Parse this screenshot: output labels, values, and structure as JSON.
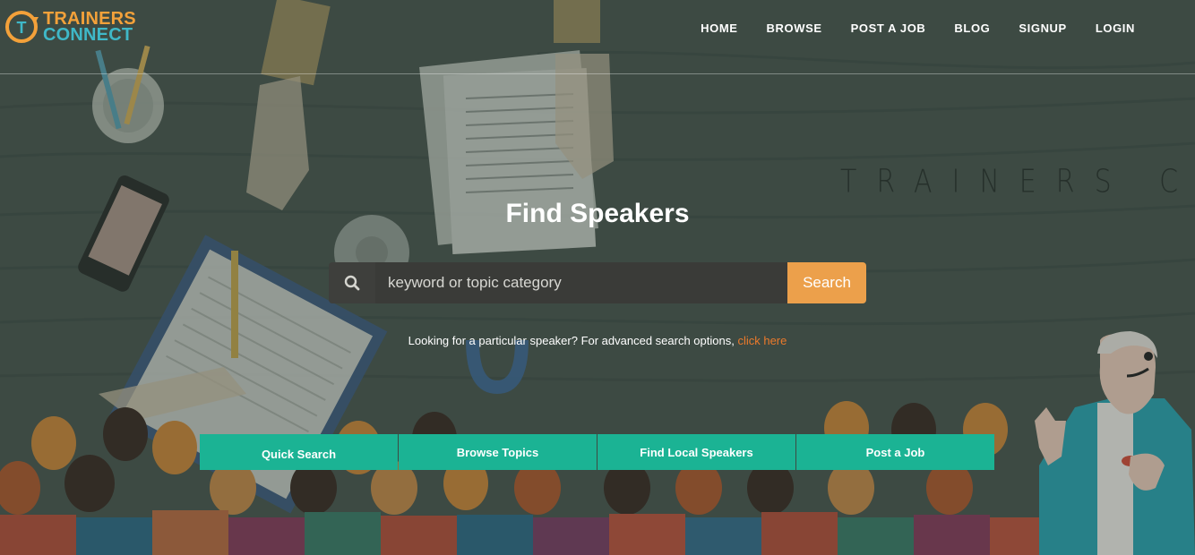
{
  "brand": {
    "line1": "TRAINERS",
    "line2": "CONNECT",
    "mark_letter": "T",
    "colors": {
      "orange": "#f3a13a",
      "teal": "#3fb8c8"
    }
  },
  "nav": {
    "items": [
      "HOME",
      "BROWSE",
      "POST A JOB",
      "BLOG",
      "SIGNUP",
      "LOGIN"
    ]
  },
  "watermark": "TRAINERS CONNECT",
  "hero": {
    "title": "Find Speakers",
    "search": {
      "placeholder": "keyword or topic category",
      "value": "",
      "button_label": "Search",
      "icon": "search-icon"
    },
    "advanced": {
      "text": "Looking for a particular speaker? For advanced search options, ",
      "link_label": "click here"
    }
  },
  "tabs": [
    "Quick Search",
    "Browse Topics",
    "Find Local Speakers",
    "Post a Job"
  ],
  "colors": {
    "background": "#4a564f",
    "search_button": "#eca04b",
    "tab_bg": "#1bb394",
    "link": "#ec7a2b"
  }
}
